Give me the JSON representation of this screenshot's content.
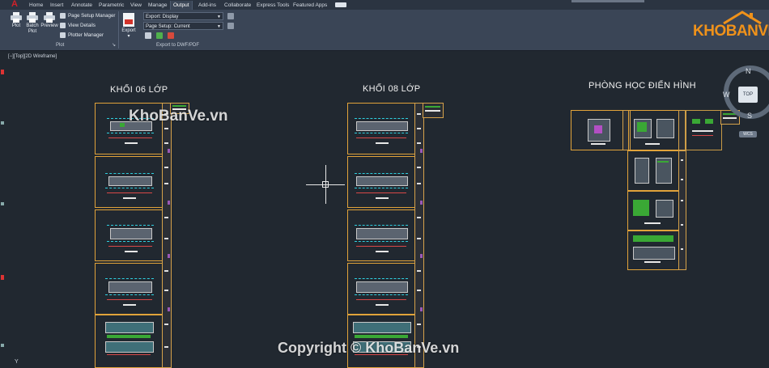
{
  "app": {
    "logo_glyph": "A",
    "logo_icon": "autocad-logo-icon"
  },
  "ribbon_tabs": [
    "Home",
    "Insert",
    "Annotate",
    "Parametric",
    "View",
    "Manage",
    "Output",
    "Add-ins",
    "Collaborate",
    "Express Tools",
    "Featured Apps"
  ],
  "active_tab": "Output",
  "plot_panel": {
    "plot_label": "Plot",
    "batch_plot_label": "Batch Plot",
    "preview_label": "Preview",
    "page_setup_manager": "Page Setup Manager",
    "view_details": "View Details",
    "plotter_manager": "Plotter Manager",
    "panel_title": "Plot"
  },
  "export_panel": {
    "export_label": "Export",
    "export_combo": "Export: Display",
    "page_setup_combo": "Page Setup: Current",
    "panel_title": "Export to DWF/PDF"
  },
  "viewport": {
    "label": "[−][Top][2D Wireframe]"
  },
  "sections": {
    "khoi06": "KHỐI 06 LỚP",
    "khoi08": "KHỐI 08 LỚP",
    "phonghoc": "PHÒNG HỌC ĐIỂN HÌNH"
  },
  "viewcube": {
    "top": "TOP",
    "north": "N",
    "south": "S",
    "west": "W",
    "wcs": "WCS"
  },
  "watermarks": {
    "site": "KhoBanVe.vn",
    "copyright": "Copyright © KhoBanVe.vn",
    "logo": "KHOBANVE"
  },
  "colors": {
    "sheet_border": "#e1a33a",
    "background": "#212830",
    "logo_orange": "#f0921a",
    "ribbon": "#3a4556"
  }
}
